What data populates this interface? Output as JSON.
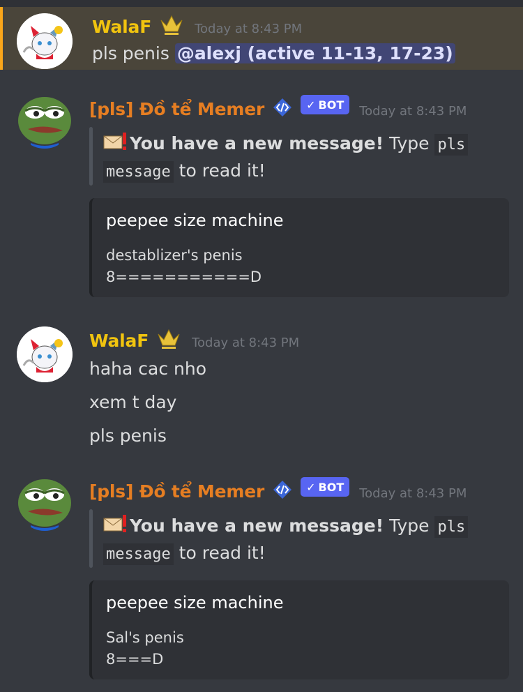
{
  "messages": [
    {
      "author": "WalaF",
      "timestamp": "Today at 8:43 PM",
      "text_prefix": "pls penis ",
      "mention": "@alexj (active 11-13, 17-23)"
    },
    {
      "author": "[pls] Đồ tể Memer",
      "bot_tag": "BOT",
      "timestamp": "Today at 8:43 PM",
      "quote_bold": "You have a new message!",
      "quote_type": " Type ",
      "quote_code1": "pls",
      "quote_code2": "message",
      "quote_tail": " to read it!",
      "embed_title": "peepee size machine",
      "embed_line1": "destablizer's penis",
      "embed_line2": "8===========D"
    },
    {
      "author": "WalaF",
      "timestamp": "Today at 8:43 PM",
      "lines": [
        "haha cac nho",
        "xem t day",
        "pls penis"
      ]
    },
    {
      "author": "[pls] Đồ tể Memer",
      "bot_tag": "BOT",
      "timestamp": "Today at 8:43 PM",
      "quote_bold": "You have a new message!",
      "quote_type": " Type ",
      "quote_code1": "pls",
      "quote_code2": "message",
      "quote_tail": " to read it!",
      "embed_title": "peepee size machine",
      "embed_line1": "Sal's penis",
      "embed_line2": "8===D"
    }
  ],
  "colors": {
    "background": "#36393f",
    "mention_highlight": "#4a453a",
    "mention_border": "#faa61a",
    "walaf_name": "#f1c40f",
    "bot_name": "#e67e22",
    "bot_tag": "#5865f2",
    "embed_bg": "#2f3136"
  },
  "icons": [
    "cat-avatar",
    "pepe-avatar",
    "crown-badge-icon",
    "developer-badge-icon",
    "envelope-icon",
    "check-icon"
  ]
}
